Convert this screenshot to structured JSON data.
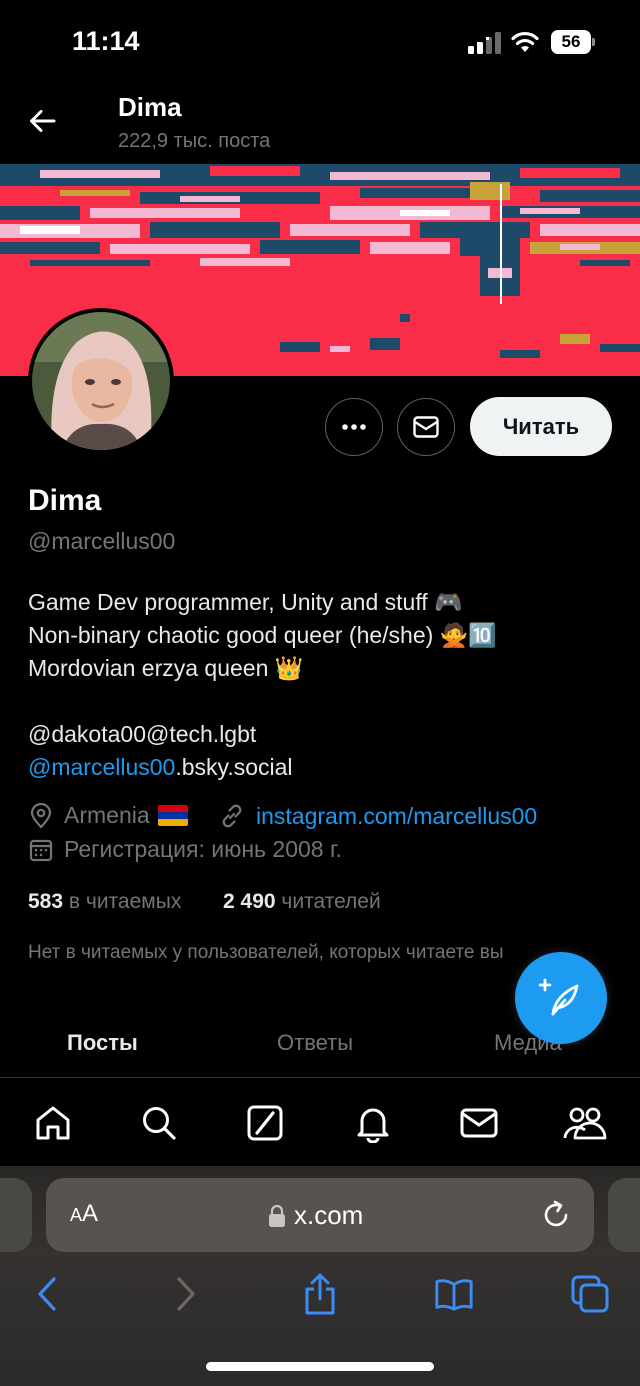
{
  "status_bar": {
    "time": "11:14",
    "battery": "56"
  },
  "header": {
    "name": "Dima",
    "post_count": "222,9 тыс. поста"
  },
  "banner": {
    "colors": [
      "#fa2d48",
      "#1e4a6a",
      "#f2b8d4",
      "#c8a23a",
      "#ffffff"
    ]
  },
  "profile": {
    "display_name": "Dima",
    "handle": "@marcellus00",
    "bio": {
      "line1": "Game Dev programmer, Unity and stuff 🎮",
      "line2": "Non-binary chaotic good queer (he/she) 🙅🔟",
      "line3": "Mordovian erzya queen 👑",
      "line4": "@dakota00@tech.lgbt",
      "line5_link": "@marcellus00",
      "line5_rest": ".bsky.social"
    },
    "location": "Armenia",
    "website": "instagram.com/marcellus00",
    "joined": "Регистрация: июнь 2008 г.",
    "following_count": "583",
    "following_label": "в читаемых",
    "followers_count": "2 490",
    "followers_label": "читателей",
    "no_followers_you_follow": "Нет в читаемых у пользователей, которых читаете вы"
  },
  "actions": {
    "follow_label": "Читать",
    "more_icon": "more-icon",
    "message_icon": "mail-icon"
  },
  "tabs": [
    {
      "label": "Посты",
      "active": true
    },
    {
      "label": "Ответы",
      "active": false
    },
    {
      "label": "Медиа",
      "active": false
    }
  ],
  "bottom_nav": {
    "items": [
      "home-icon",
      "search-icon",
      "grok-icon",
      "notifications-icon",
      "messages-icon",
      "communities-icon"
    ]
  },
  "browser": {
    "aa_label_big": "A",
    "aa_label_small": "A",
    "url": "x.com"
  },
  "colors": {
    "accent": "#1d9bf0",
    "text_secondary": "#71767b",
    "background": "#000000"
  }
}
